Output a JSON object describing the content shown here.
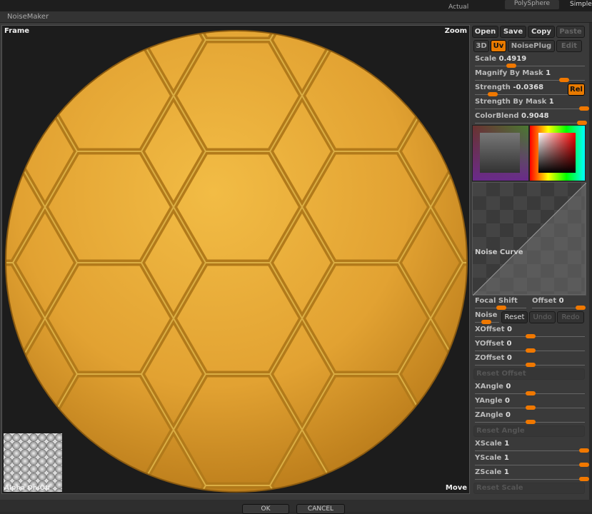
{
  "top": {
    "actual": "Actual",
    "polysphere": "PolySphere",
    "simple": "SimpleB"
  },
  "window_title": "NoiseMaker",
  "viewport": {
    "frame": "Frame",
    "zoom": "Zoom",
    "move": "Move",
    "alpha": "Alpha On/Off"
  },
  "toolbar": {
    "open": "Open",
    "save": "Save",
    "copy": "Copy",
    "paste": "Paste",
    "mode_3d": "3D",
    "uv": "Uv",
    "noiseplug": "NoisePlug",
    "edit": "Edit",
    "rel": "Rel"
  },
  "sliders_top": [
    {
      "label": "Scale",
      "value": "0.4919",
      "level": 0.33
    },
    {
      "label": "Magnify By Mask",
      "value": "1",
      "level": 0.8
    },
    {
      "label": "Strength",
      "value": "-0.0368",
      "level": 0.16
    },
    {
      "label": "Strength By Mask",
      "value": "1",
      "level": 0.98
    },
    {
      "label": "ColorBlend",
      "value": "0.9048",
      "level": 0.96
    }
  ],
  "noise_curve": "Noise Curve",
  "focal": {
    "label": "Focal Shift",
    "offset_label": "Offset",
    "offset_value": "0"
  },
  "noise": {
    "label": "Noise",
    "reset": "Reset",
    "undo": "Undo",
    "redo": "Redo"
  },
  "sliders_offset": [
    {
      "label": "XOffset",
      "value": "0",
      "level": 0.5
    },
    {
      "label": "YOffset",
      "value": "0",
      "level": 0.5
    },
    {
      "label": "ZOffset",
      "value": "0",
      "level": 0.5
    }
  ],
  "reset_offset": "Reset Offset",
  "sliders_angle": [
    {
      "label": "XAngle",
      "value": "0",
      "level": 0.5
    },
    {
      "label": "YAngle",
      "value": "0",
      "level": 0.5
    },
    {
      "label": "ZAngle",
      "value": "0",
      "level": 0.5
    }
  ],
  "reset_angle": "Reset Angle",
  "sliders_scale": [
    {
      "label": "XScale",
      "value": "1",
      "level": 0.98
    },
    {
      "label": "YScale",
      "value": "1",
      "level": 0.98
    },
    {
      "label": "ZScale",
      "value": "1",
      "level": 0.98
    }
  ],
  "reset_scale": "Reset Scale",
  "dialog": {
    "ok": "OK",
    "cancel": "CANCEL"
  },
  "colors": {
    "accent": "#f07800",
    "sphere": "#e0a030"
  }
}
